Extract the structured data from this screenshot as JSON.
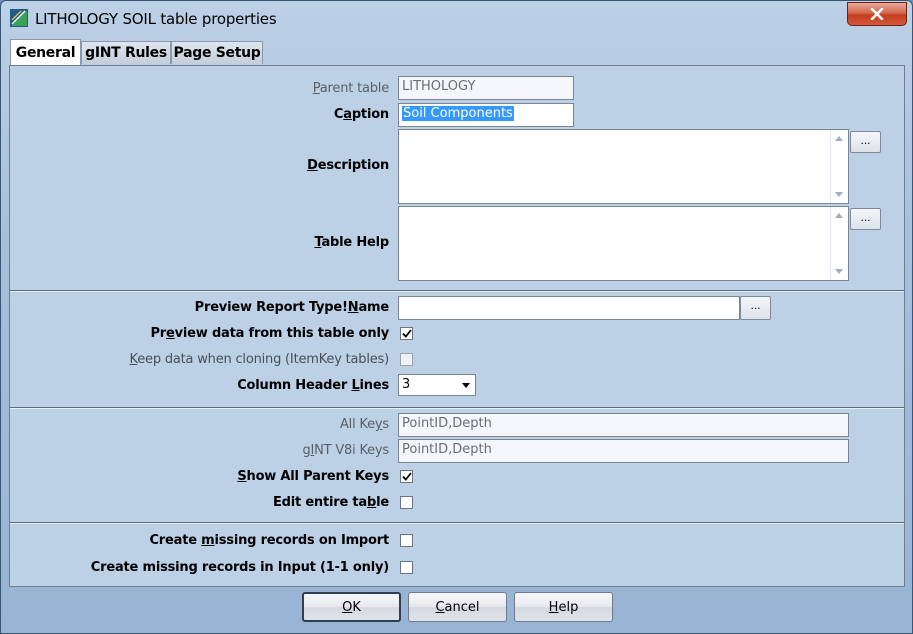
{
  "window": {
    "title": "LITHOLOGY SOIL table properties",
    "close_symbol": "✕"
  },
  "tabs": [
    {
      "label": "General",
      "active": true
    },
    {
      "label": "gINT Rules",
      "active": false
    },
    {
      "label": "Page Setup",
      "active": false
    }
  ],
  "general": {
    "parent_table": {
      "pre": "",
      "key": "P",
      "post": "arent table",
      "value": "LITHOLOGY"
    },
    "caption": {
      "pre": "C",
      "key": "a",
      "post": "ption",
      "value": "Soil Components"
    },
    "description": {
      "pre": "",
      "key": "D",
      "post": "escription",
      "value": ""
    },
    "table_help": {
      "pre": "",
      "key": "T",
      "post": "able Help",
      "value": ""
    },
    "ellipsis_label": "...",
    "preview_report": {
      "pre": "Preview Report Type!",
      "key": "N",
      "post": "ame",
      "value": ""
    },
    "preview_data_only": {
      "pre": "Pr",
      "key": "e",
      "post": "view data from this table only",
      "checked": true
    },
    "keep_data_cloning": {
      "pre": "",
      "key": "K",
      "post": "eep data when cloning (ItemKey tables)",
      "checked": false
    },
    "column_header_lines": {
      "pre": "Column Header ",
      "key": "L",
      "post": "ines",
      "value": "3"
    },
    "all_keys": {
      "pre": "All Ke",
      "key": "y",
      "post": "s",
      "value": "PointID,Depth"
    },
    "gint_v8i_keys": {
      "pre": "g",
      "key": "I",
      "post": "NT V8i Keys",
      "value": "PointID,Depth"
    },
    "show_all_parent_keys": {
      "pre": "",
      "key": "S",
      "post": "how All Parent Keys",
      "checked": true
    },
    "edit_entire_table": {
      "pre": "Edit entire ta",
      "key": "b",
      "post": "le",
      "checked": false
    },
    "create_missing_import": {
      "pre": "Create ",
      "key": "m",
      "post": "issing records on Import",
      "checked": false
    },
    "create_missing_input": {
      "pre": "Create missing records in Input (1-1 only)",
      "key": "",
      "post": "",
      "checked": false
    }
  },
  "buttons": {
    "ok": {
      "pre": "",
      "key": "O",
      "post": "K"
    },
    "cancel": {
      "pre": "",
      "key": "C",
      "post": "ancel"
    },
    "help": {
      "pre": "",
      "key": "H",
      "post": "elp"
    }
  }
}
